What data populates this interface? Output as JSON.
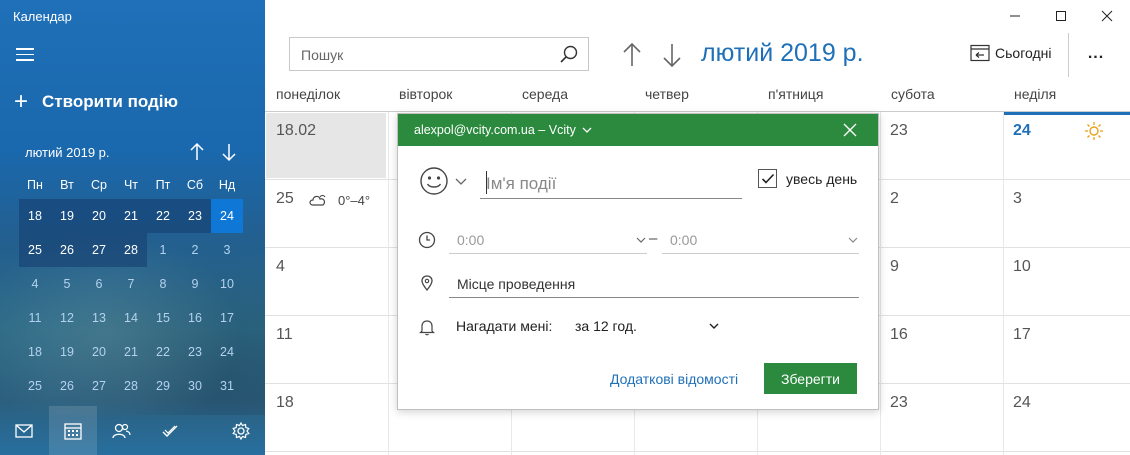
{
  "window": {
    "title": "Календар"
  },
  "sidebar": {
    "new_event_label": "Створити подію",
    "mini_calendar": {
      "month": "лютий 2019 р.",
      "weekdays": [
        "Пн",
        "Вт",
        "Ср",
        "Чт",
        "Пт",
        "Сб",
        "Нд"
      ],
      "weeks": [
        [
          "18",
          "19",
          "20",
          "21",
          "22",
          "23",
          "24"
        ],
        [
          "25",
          "26",
          "27",
          "28",
          "1",
          "2",
          "3"
        ],
        [
          "4",
          "5",
          "6",
          "7",
          "8",
          "9",
          "10"
        ],
        [
          "11",
          "12",
          "13",
          "14",
          "15",
          "16",
          "17"
        ],
        [
          "18",
          "19",
          "20",
          "21",
          "22",
          "23",
          "24"
        ],
        [
          "25",
          "26",
          "27",
          "28",
          "29",
          "30",
          "31"
        ]
      ],
      "today": "24"
    },
    "bottom_nav": [
      "mail-icon",
      "calendar-icon",
      "people-icon",
      "todo-icon",
      "settings-icon"
    ]
  },
  "header": {
    "search_placeholder": "Пошук",
    "month_title": "лютий 2019 р.",
    "today_label": "Сьогодні",
    "more_label": "..."
  },
  "calendar": {
    "weekday_headers": [
      "понеділок",
      "вівторок",
      "середа",
      "четвер",
      "п'ятниця",
      "субота",
      "неділя"
    ],
    "visible_days": {
      "row1": {
        "mon": "18.02",
        "sat": "23",
        "sun": "24"
      },
      "row2": {
        "mon": "25",
        "sat": "2",
        "sun": "3"
      },
      "row3": {
        "mon": "4",
        "sat": "9",
        "sun": "10"
      },
      "row4": {
        "mon": "11",
        "sat": "16",
        "sun": "17"
      },
      "row5": {
        "mon": "18",
        "sat": "23",
        "sun": "24"
      }
    },
    "weather": {
      "temp": "0°–4°"
    }
  },
  "popup": {
    "account": "alexpol@vcity.com.ua – Vcity",
    "event_name_placeholder": "Ім'я події",
    "all_day_label": "увесь день",
    "all_day_checked": true,
    "start_time": "0:00",
    "end_time": "0:00",
    "time_separator": "–",
    "location_placeholder": "Місце проведення",
    "reminder_label": "Нагадати мені:",
    "reminder_value": "за 12 год.",
    "more_details_label": "Додаткові відомості",
    "save_label": "Зберегти"
  },
  "colors": {
    "accent": "#1f70b8",
    "green": "#2b8a3e",
    "today_mini": "#0f77d5"
  }
}
